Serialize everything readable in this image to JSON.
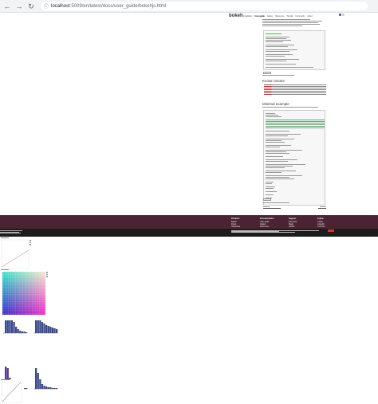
{
  "browser": {
    "back_icon": "arrow-left-icon",
    "forward_icon": "arrow-right-icon",
    "reload_icon": "reload-icon",
    "url_host": "localhost",
    "url_path": ":5009/en/latest/docs/user_guide/bokehjs.html"
  },
  "doc": {
    "logo": "bokeh",
    "nav": [
      "Installation",
      "User guide",
      "Gallery",
      "Reference",
      "Tutorial",
      "Community",
      "About"
    ],
    "known_issues_heading": "Known issues",
    "minimal_example_heading": "Minimal example"
  },
  "footer": {
    "columns": [
      {
        "title": "Products",
        "items": [
          "Bokeh",
          "Panel",
          "HoloViews"
        ]
      },
      {
        "title": "Documentation",
        "items": [
          "User guide",
          "Gallery",
          "Reference"
        ]
      },
      {
        "title": "Support",
        "items": [
          "Discourse",
          "Slack",
          "GitHub"
        ]
      },
      {
        "title": "Follow",
        "items": [
          "Twitter",
          "LinkedIn",
          "YouTube"
        ]
      }
    ]
  },
  "colors": {
    "footer": "#4a2432",
    "footer_bottom": "#1c1c1c",
    "accent_red": "#e03030",
    "bar_blue": "#3b4a8f",
    "bar_purple": "#5a3a8a"
  }
}
